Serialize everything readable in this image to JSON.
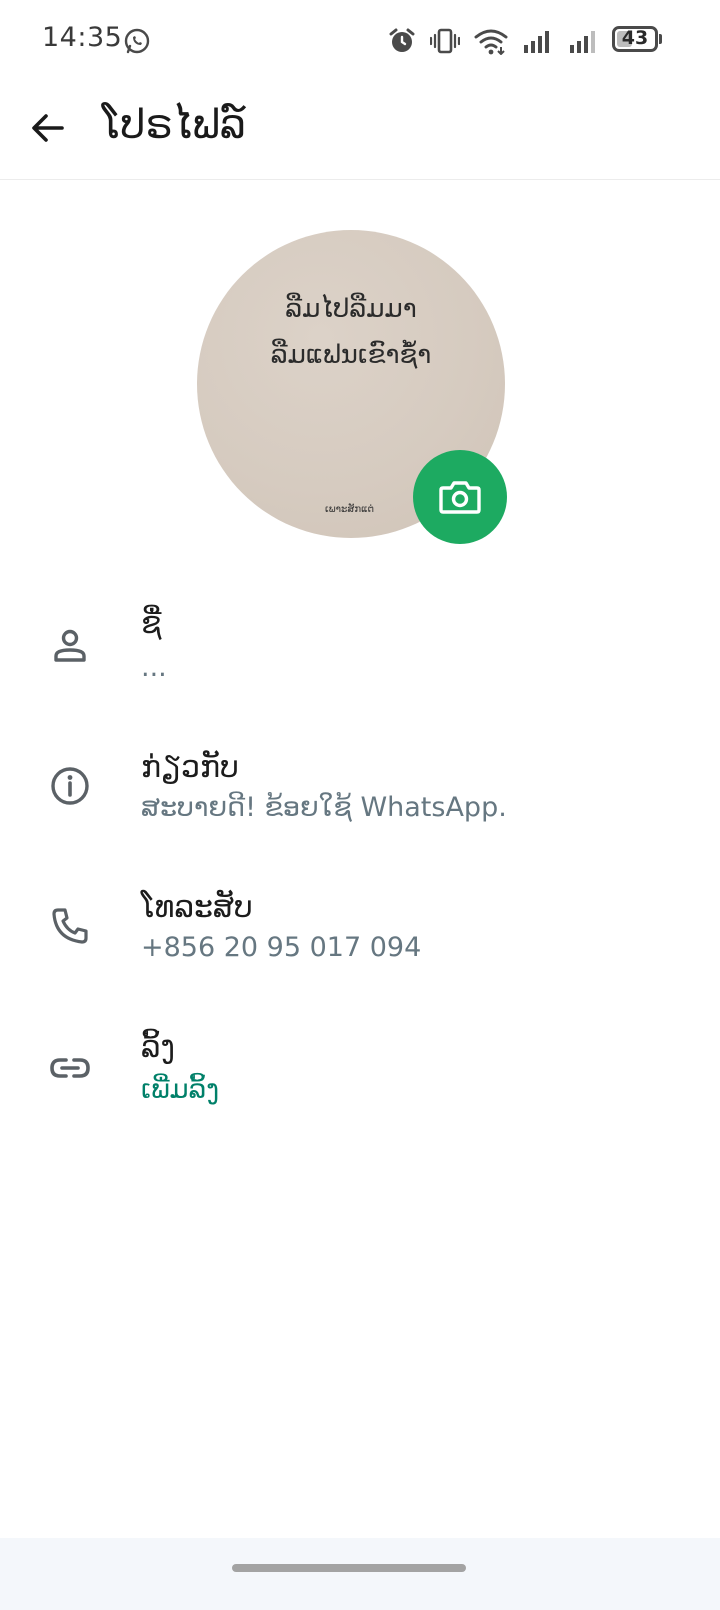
{
  "status_bar": {
    "time": "14:35",
    "battery": "43",
    "battery_level": 0.43
  },
  "app_bar": {
    "title": "ໂປຣໄຟລ໌"
  },
  "avatar": {
    "line1": "ລືມໄປລືມມາ",
    "line2": "ລືມແຟນເຂົາຊ້ຳ",
    "signature": "ເພາະສັກແຕ່"
  },
  "rows": {
    "name": {
      "label": "ຊື່",
      "value": "...",
      "icon": "person-icon"
    },
    "about": {
      "label": "ກ່ຽວກັບ",
      "value": "ສະບາຍດີ! ຂ້ອຍໃຊ້ WhatsApp.",
      "icon": "info-icon"
    },
    "phone": {
      "label": "ໂທລະສັບ",
      "value": "+856 20 95 017 094",
      "icon": "phone-icon"
    },
    "links": {
      "label": "ລິ້ງ",
      "value": "ເພີ່ມລິ້ງ",
      "icon": "link-icon"
    }
  },
  "colors": {
    "accent": "#1daa61",
    "link_green": "#008069",
    "secondary_text": "#667781"
  }
}
